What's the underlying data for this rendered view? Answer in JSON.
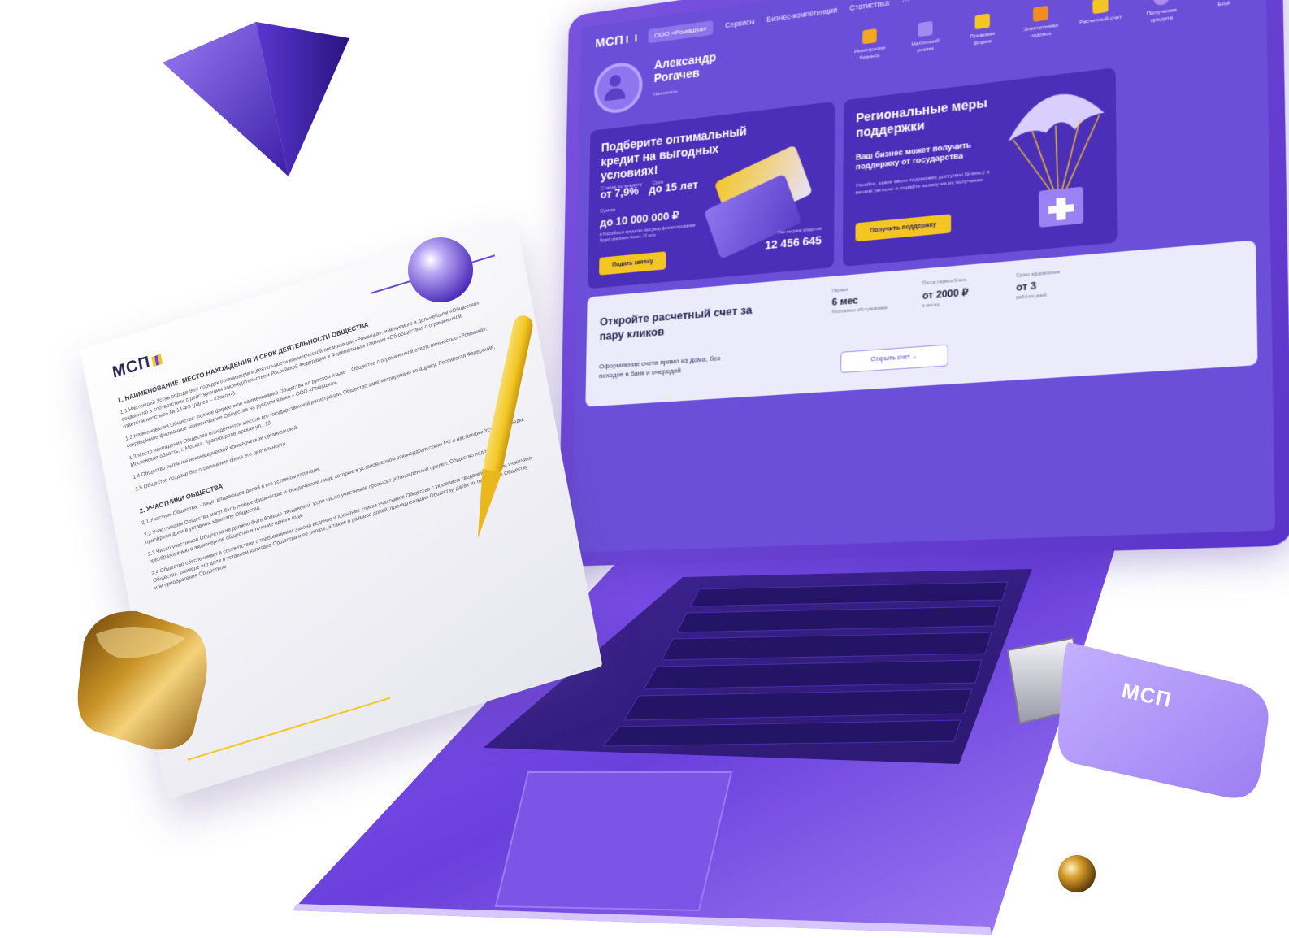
{
  "document": {
    "logo": "МСП",
    "section1_title": "1.  НАИМЕНОВАНИЕ, МЕСТО НАХОЖДЕНИЯ И СРОК ДЕЯТЕЛЬНОСТИ ОБЩЕСТВА",
    "section1_text": "1.1  Настоящий Устав определяет порядок организации и деятельности коммерческой организации «Ромашка», именуемого в дальнейшем «Общество», созданного в соответствии с действующим законодательством Российской Федерации и Федеральным законом «Об обществах с ограниченной ответственностью» № 14-ФЗ (далее – «Закон»).",
    "section1_text2": "1.2  Наименования Общества: полное фирменное наименование Общества на русском языке – Общество с ограниченной ответственностью «Ромашка»; сокращённое фирменное наименование Общества на русском языке – ООО «Ромашка».",
    "section1_text3": "1.3  Место нахождения Общества определяется местом его государственной регистрации. Общество зарегистрировано по адресу: Российская Федерация, Московская область, г. Москва, Краснопролетарская ул., 12",
    "section1_text4": "1.4  Общество является некоммерческой коммерческой организацией.",
    "section1_text5": "1.5  Общество создано без ограничения срока его деятельности.",
    "section2_title": "2.  УЧАСТНИКИ ОБЩЕСТВА",
    "section2_text": "2.1  Участник Общества – лицо, владеющее долей в его уставном капитале.",
    "section2_text2": "2.2  Участниками Общества могут быть любые физические и юридические лица, которые в установленном законодательством РФ и настоящим Уставом порядке приобрели доли в уставном капитале Общества.",
    "section2_text3": "2.3  Число участников Общества не должно быть больше пятидесяти. Если число участников превысит установленный предел, Общество подлежит преобразованию в акционерное общество в течение одного года.",
    "section2_text4": "2.4  Общество обеспечивает в соответствии с требованиями Закона ведение и хранение списка участников Общества с указанием сведений о каждом участнике Общества, размере его доли в уставном капитале Общества и её оплате, а также о размере долей, принадлежащих Обществу, датах их перехода к Обществу или приобретения Обществом."
  },
  "app": {
    "logo": "МСП",
    "nav": {
      "org": "ООО «Ромашка»",
      "items": [
        "Сервисы",
        "Бизнес-компетенции",
        "Статистика"
      ],
      "more": "···"
    },
    "icons": [
      "search-icon",
      "bell-icon",
      "avatar"
    ],
    "profile": {
      "name": "Александр Рогачев",
      "sub": "Настроить"
    },
    "services": [
      {
        "label": "Регистрация бизнеса",
        "color": "#f3a623"
      },
      {
        "label": "Налоговый режим",
        "color": "#a08cf0"
      },
      {
        "label": "Правовая форма",
        "color": "#f3c623"
      },
      {
        "label": "Электронная подпись",
        "color": "#f38b23"
      },
      {
        "label": "Расчетный счет",
        "color": "#f3c623"
      },
      {
        "label": "Получение кредита",
        "color": "#b18cf0"
      },
      {
        "label": "Ещё",
        "color": "transparent"
      }
    ],
    "credit_card": {
      "title": "Подберите оптимальный кредит на выгодных условиях!",
      "rate_label": "Ставка по кредиту",
      "term_label": "Срок",
      "rate": "от 7,9%",
      "term": "до 15 лет",
      "sum_label": "Сумма",
      "sum": "до 10 000 000 ₽",
      "sum_note": "в Российских кредитах на сумму финансирования будет увеличен более 10 млн",
      "issued_label": "Уже выдано кредитов",
      "issued": "12 456 645",
      "button": "Подать заявку"
    },
    "support_card": {
      "title": "Региональные меры поддержки",
      "subtitle": "Ваш бизнес может получить поддержку от государства",
      "text": "Узнайте, какие меры поддержки доступны бизнесу в вашем регионе и подайте заявку на их получение",
      "button": "Получить поддержку"
    },
    "account": {
      "title": "Откройте расчетный счет за пару кликов",
      "desc": "Оформление счета прямо из дома, без походов в банк и очередей",
      "stats": [
        {
          "label": "Первые",
          "value": "6 мес",
          "note": "бесплатное обслуживание"
        },
        {
          "label": "После первых 6 мес",
          "value": "от 2000 ₽",
          "note": "в месяц"
        },
        {
          "label": "Сроки оформления",
          "value": "от 3",
          "note": "рабочих дней"
        }
      ],
      "button": "Открыть счет"
    }
  },
  "usb": {
    "logo": "МСП"
  },
  "colors": {
    "brand_purple": "#6b4fd8",
    "dark_purple": "#4c2fb8",
    "accent_yellow": "#f3c623",
    "light_bg": "#ecebfb"
  }
}
